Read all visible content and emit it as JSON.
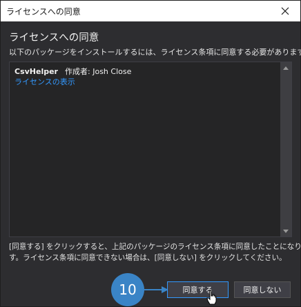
{
  "window": {
    "title": "ライセンスへの同意",
    "close_icon": "close-icon"
  },
  "main": {
    "heading": "ライセンスへの同意",
    "subheading": "以下のパッケージをインストールするには、ライセンス条項に同意する必要があります。",
    "packages": [
      {
        "name": "CsvHelper",
        "author_label": "作成者:",
        "author": "Josh Close",
        "license_link": "ライセンスの表示"
      }
    ],
    "footer_lines": [
      "[同意する] をクリックすると、上記のパッケージのライセンス条項に同意したことになりま",
      "す。ライセンス条項に同意できない場合は、[同意しない] をクリックしてください。"
    ]
  },
  "buttons": {
    "agree": "同意する",
    "disagree": "同意しない"
  },
  "annotation": {
    "step_number": "10",
    "badge_color": "#3a84c6"
  },
  "colors": {
    "link": "#3399ff",
    "background": "#2d2d30",
    "accent_border": "#3399ff"
  }
}
